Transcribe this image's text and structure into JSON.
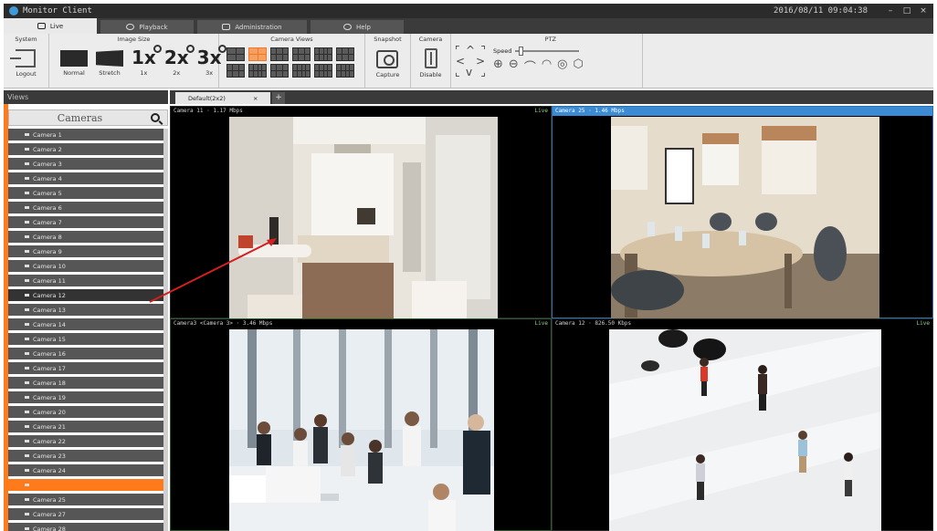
{
  "window": {
    "title": "Monitor Client",
    "clock": "2016/08/11 09:04:38",
    "controls": [
      "–",
      "□",
      "×"
    ]
  },
  "main_tabs": [
    {
      "label": "Live",
      "icon": "monitor-icon",
      "active": true
    },
    {
      "label": "Playback",
      "icon": "play-icon",
      "active": false
    },
    {
      "label": "Administration",
      "icon": "admin-icon",
      "active": false
    },
    {
      "label": "Help",
      "icon": "help-icon",
      "active": false
    }
  ],
  "ribbon": {
    "system": {
      "title": "System",
      "logout": "Logout"
    },
    "image_size": {
      "title": "Image Size",
      "normal": "Normal",
      "stretch": "Stretch",
      "x1": "1x",
      "x2": "2x",
      "x3": "3x"
    },
    "camera_views": {
      "title": "Camera Views"
    },
    "snapshot": {
      "title": "Snapshot",
      "capture": "Capture"
    },
    "camera": {
      "title": "Camera",
      "disable": "Disable"
    },
    "ptz": {
      "title": "PTZ",
      "speed": "Speed",
      "speed_level": 0.05
    }
  },
  "sidebar": {
    "views_title": "Views",
    "cameras_label": "Cameras",
    "accent": "#ff7a1a",
    "cameras": [
      "Camera 1",
      "Camera 2",
      "Camera 3",
      "Camera 4",
      "Camera 5",
      "Camera 6",
      "Camera 7",
      "Camera 8",
      "Camera 9",
      "Camera 10",
      "Camera 11",
      "Camera 12",
      "Camera 13",
      "Camera 14",
      "Camera 15",
      "Camera 16",
      "Camera 17",
      "Camera 18",
      "Camera 19",
      "Camera 20",
      "Camera 21",
      "Camera 22",
      "Camera 23",
      "Camera 24",
      "",
      "Camera 25",
      "Camera 27",
      "Camera 28"
    ]
  },
  "doc_tab": {
    "label": "Default(2x2)",
    "close": "×",
    "add": "+"
  },
  "panes": [
    {
      "header": "Camera 11 · 1.17 Mbps",
      "live": "Live"
    },
    {
      "header": "Camera 25 · 1.46 Mbps",
      "live": ""
    },
    {
      "header": "Camera3 <Camera 3> · 3.46 Mbps",
      "live": "Live"
    },
    {
      "header": "Camera 12 · 826.50 Kbps",
      "live": "Live"
    }
  ]
}
